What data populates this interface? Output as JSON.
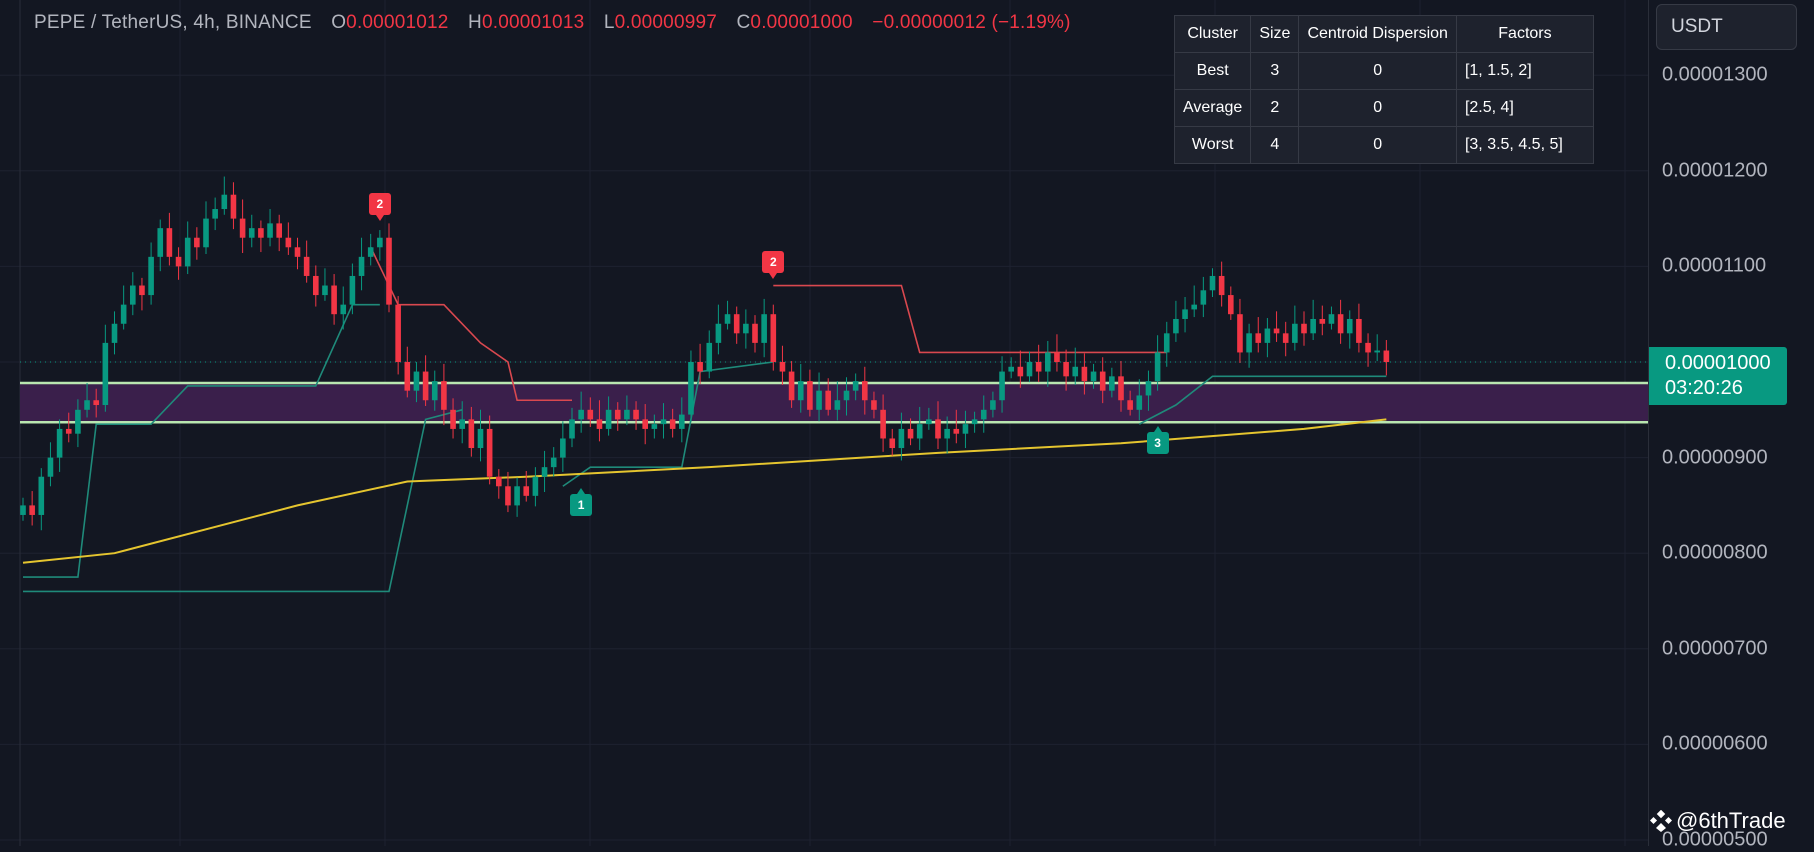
{
  "header": {
    "symbol": "PEPE / TetherUS, 4h, BINANCE",
    "o_label": "O",
    "o_value": "0.00001012",
    "h_label": "H",
    "h_value": "0.00001013",
    "l_label": "L",
    "l_value": "0.00000997",
    "c_label": "C",
    "c_value": "0.00001000",
    "change": "−0.00000012 (−1.19%)"
  },
  "table": {
    "headers": [
      "Cluster",
      "Size",
      "Centroid Dispersion",
      "Factors"
    ],
    "rows": [
      {
        "cluster": "Best",
        "size": "3",
        "dispersion": "0",
        "factors": "[1, 1.5, 2]"
      },
      {
        "cluster": "Average",
        "size": "2",
        "dispersion": "0",
        "factors": "[2.5, 4]"
      },
      {
        "cluster": "Worst",
        "size": "4",
        "dispersion": "0",
        "factors": "[3, 3.5, 4.5, 5]"
      }
    ]
  },
  "axis": {
    "currency": "USDT",
    "ticks": [
      "0.00001300",
      "0.00001200",
      "0.00001100",
      "0.00001000",
      "0.00000900",
      "0.00000800",
      "0.00000700",
      "0.00000600",
      "0.00000500"
    ],
    "last_price": "0.00001000",
    "countdown": "03:20:26"
  },
  "watermark": "@6thTrade",
  "colors": {
    "up": "#089981",
    "down": "#f23645",
    "ema": "#e5c52f",
    "band": "#3a1f4b",
    "band_line": "#b9e6b0"
  },
  "chart_data": {
    "type": "candlestick",
    "unit": "1e-8 USDT",
    "ylim": [
      500,
      1300
    ],
    "closes": [
      850,
      840,
      880,
      900,
      930,
      925,
      950,
      960,
      955,
      1020,
      1040,
      1060,
      1080,
      1070,
      1110,
      1140,
      1110,
      1100,
      1130,
      1120,
      1150,
      1160,
      1175,
      1150,
      1130,
      1140,
      1130,
      1145,
      1130,
      1120,
      1110,
      1090,
      1070,
      1080,
      1050,
      1060,
      1090,
      1110,
      1120,
      1130,
      1060,
      1000,
      970,
      990,
      960,
      980,
      950,
      930,
      940,
      910,
      930,
      880,
      870,
      850,
      870,
      860,
      880,
      890,
      900,
      920,
      940,
      950,
      940,
      930,
      950,
      940,
      950,
      940,
      930,
      935,
      940,
      930,
      945,
      1000,
      990,
      1020,
      1040,
      1050,
      1030,
      1040,
      1020,
      1050,
      1000,
      990,
      960,
      980,
      950,
      970,
      950,
      960,
      970,
      980,
      960,
      950,
      920,
      910,
      930,
      920,
      935,
      940,
      920,
      930,
      925,
      935,
      940,
      950,
      960,
      990,
      995,
      985,
      1000,
      990,
      1010,
      1000,
      985,
      995,
      980,
      990,
      970,
      985,
      960,
      950,
      965,
      980,
      1010,
      1030,
      1045,
      1055,
      1060,
      1075,
      1090,
      1070,
      1050,
      1010,
      1030,
      1020,
      1035,
      1030,
      1020,
      1040,
      1030,
      1045,
      1040,
      1050,
      1030,
      1045,
      1020,
      1010,
      1012,
      1000
    ],
    "ema": [
      [
        0,
        790
      ],
      [
        10,
        800
      ],
      [
        30,
        850
      ],
      [
        42,
        875
      ],
      [
        55,
        880
      ],
      [
        75,
        890
      ],
      [
        100,
        905
      ],
      [
        120,
        915
      ],
      [
        140,
        930
      ],
      [
        149,
        940
      ]
    ],
    "bull_lines": [
      [
        [
          0,
          775
        ],
        [
          6,
          775
        ],
        [
          8,
          935
        ],
        [
          14,
          935
        ],
        [
          18,
          975
        ],
        [
          32,
          975
        ],
        [
          36,
          1060
        ],
        [
          39,
          1060
        ]
      ],
      [
        [
          0,
          760
        ],
        [
          40,
          760
        ],
        [
          44,
          940
        ],
        [
          48,
          950
        ]
      ],
      [
        [
          59,
          870
        ],
        [
          62,
          890
        ],
        [
          72,
          890
        ],
        [
          74,
          990
        ],
        [
          82,
          1000
        ]
      ],
      [
        [
          122,
          935
        ],
        [
          126,
          955
        ],
        [
          130,
          985
        ],
        [
          149,
          985
        ]
      ]
    ],
    "bear_lines": [
      [
        [
          38,
          1120
        ],
        [
          41,
          1060
        ],
        [
          46,
          1060
        ],
        [
          50,
          1020
        ],
        [
          53,
          1000
        ],
        [
          54,
          960
        ],
        [
          60,
          960
        ]
      ],
      [
        [
          82,
          1080
        ],
        [
          96,
          1080
        ],
        [
          98,
          1010
        ],
        [
          125,
          1010
        ]
      ]
    ],
    "band": [
      937,
      978
    ],
    "markers": [
      {
        "label": "2",
        "kind": "bear",
        "index": 39,
        "price": 1145
      },
      {
        "label": "2",
        "kind": "bear",
        "index": 82,
        "price": 1085
      },
      {
        "label": "1",
        "kind": "bull",
        "index": 61,
        "price": 870
      },
      {
        "label": "3",
        "kind": "bull",
        "index": 124,
        "price": 935
      }
    ]
  }
}
